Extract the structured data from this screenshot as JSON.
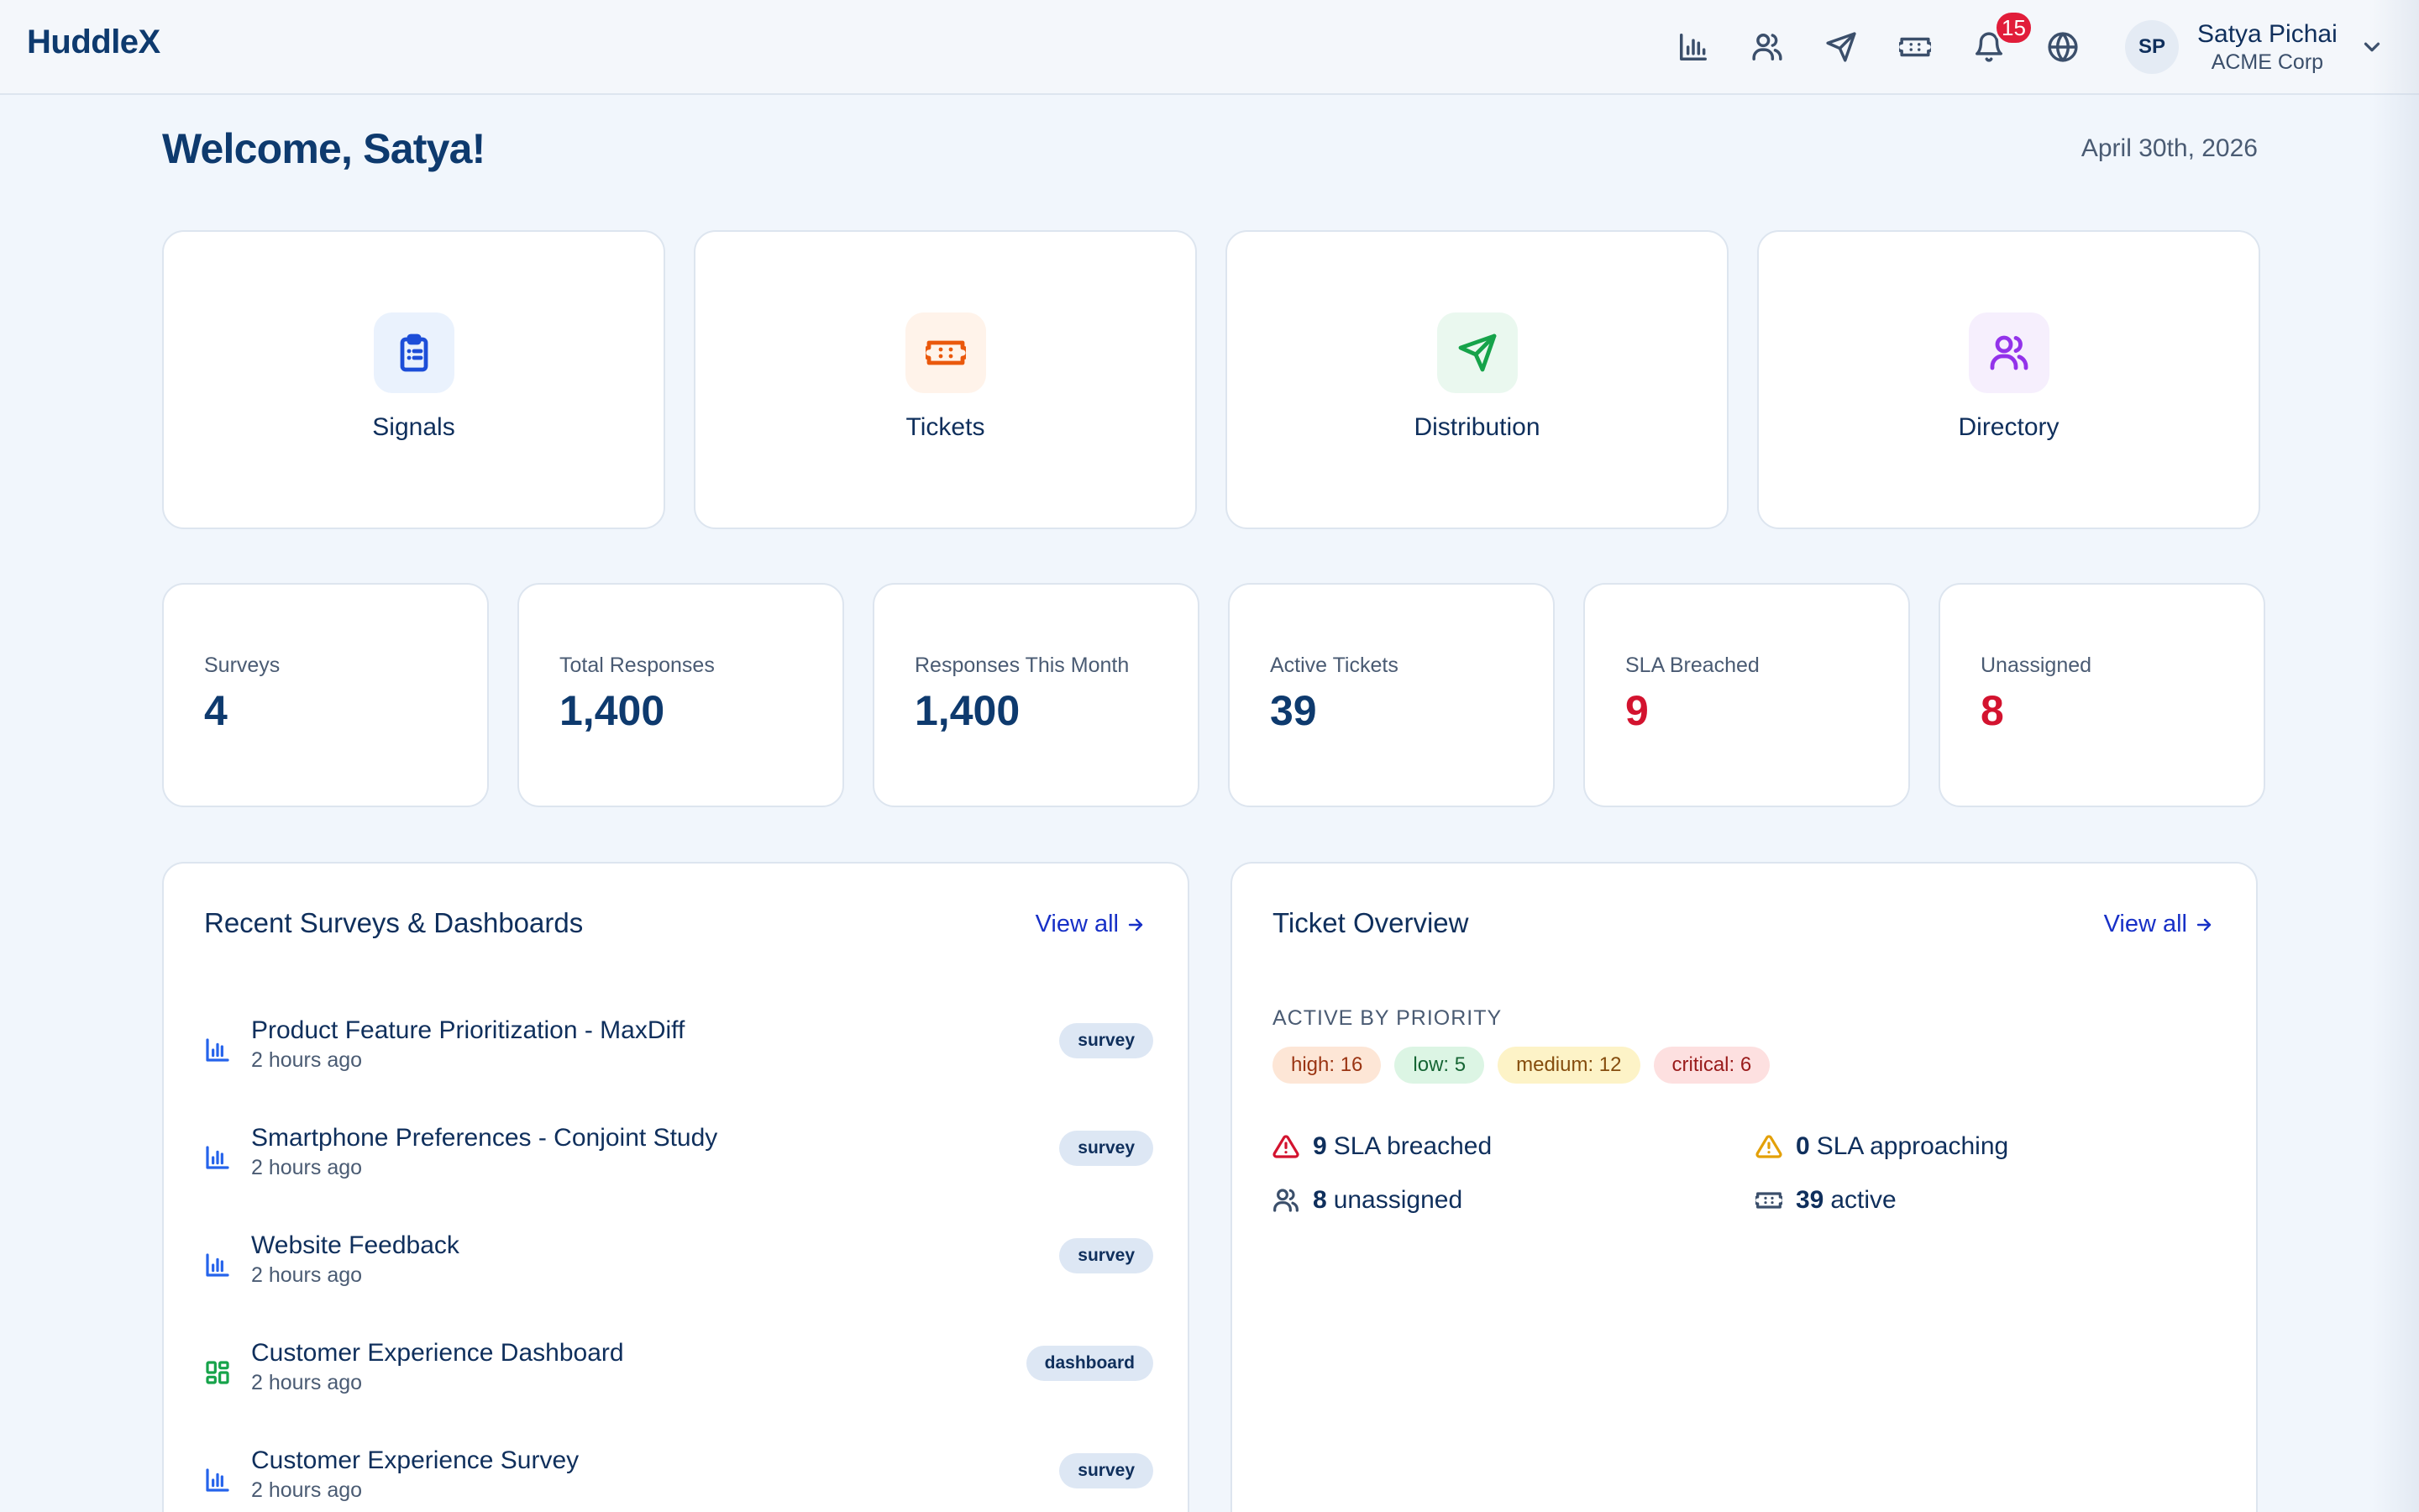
{
  "brand": "HuddleX",
  "nav": {
    "icons": [
      "bar-chart-icon",
      "users-icon",
      "send-icon",
      "ticket-icon",
      "bell-icon",
      "globe-icon"
    ],
    "notification_count": "15"
  },
  "user": {
    "initials": "SP",
    "name": "Satya Pichai",
    "org": "ACME Corp"
  },
  "welcome": "Welcome, Satya!",
  "date": "April 30th, 2026",
  "modules": [
    {
      "label": "Signals",
      "icon": "clipboard-list-icon",
      "color": "#1d4ed8",
      "bg": "#eaf2fd"
    },
    {
      "label": "Tickets",
      "icon": "ticket-icon",
      "color": "#ea580c",
      "bg": "#fff3ea"
    },
    {
      "label": "Distribution",
      "icon": "send-icon",
      "color": "#16a34a",
      "bg": "#eaf8ef"
    },
    {
      "label": "Directory",
      "icon": "users-icon",
      "color": "#9333ea",
      "bg": "#f6effd"
    }
  ],
  "stats": [
    {
      "label": "Surveys",
      "value": "4"
    },
    {
      "label": "Total Responses",
      "value": "1,400"
    },
    {
      "label": "Responses This Month",
      "value": "1,400"
    },
    {
      "label": "Active Tickets",
      "value": "39"
    },
    {
      "label": "SLA Breached",
      "value": "9"
    },
    {
      "label": "Unassigned",
      "value": "8"
    }
  ],
  "recent": {
    "title": "Recent Surveys & Dashboards",
    "view_all": "View all",
    "items": [
      {
        "title": "Product Feature Prioritization - MaxDiff",
        "time": "2 hours ago",
        "type": "survey",
        "icon": "bar-chart-icon"
      },
      {
        "title": "Smartphone Preferences - Conjoint Study",
        "time": "2 hours ago",
        "type": "survey",
        "icon": "bar-chart-icon"
      },
      {
        "title": "Website Feedback",
        "time": "2 hours ago",
        "type": "survey",
        "icon": "bar-chart-icon"
      },
      {
        "title": "Customer Experience Dashboard",
        "time": "2 hours ago",
        "type": "dashboard",
        "icon": "layout-grid-icon"
      },
      {
        "title": "Customer Experience Survey",
        "time": "2 hours ago",
        "type": "survey",
        "icon": "bar-chart-icon"
      }
    ]
  },
  "tickets": {
    "title": "Ticket Overview",
    "view_all": "View all",
    "priority_label": "Active by Priority",
    "priorities": [
      {
        "label": "high: 16",
        "bg": "#fde6d6",
        "color": "#9a3412"
      },
      {
        "label": "low: 5",
        "bg": "#dcf5e4",
        "color": "#166534"
      },
      {
        "label": "medium: 12",
        "bg": "#fdf3c7",
        "color": "#854d0e"
      },
      {
        "label": "critical: 6",
        "bg": "#fde0e0",
        "color": "#991b1b"
      }
    ],
    "summary": [
      {
        "value": "9",
        "text": "SLA breached",
        "icon": "alert-triangle-icon",
        "color": "#d3132f"
      },
      {
        "value": "0",
        "text": "SLA approaching",
        "icon": "alert-triangle-icon",
        "color": "#e3a008"
      },
      {
        "value": "8",
        "text": "unassigned",
        "icon": "users-icon",
        "color": "#3b4f6b"
      },
      {
        "value": "39",
        "text": "active",
        "icon": "ticket-icon",
        "color": "#3b4f6b"
      }
    ]
  }
}
